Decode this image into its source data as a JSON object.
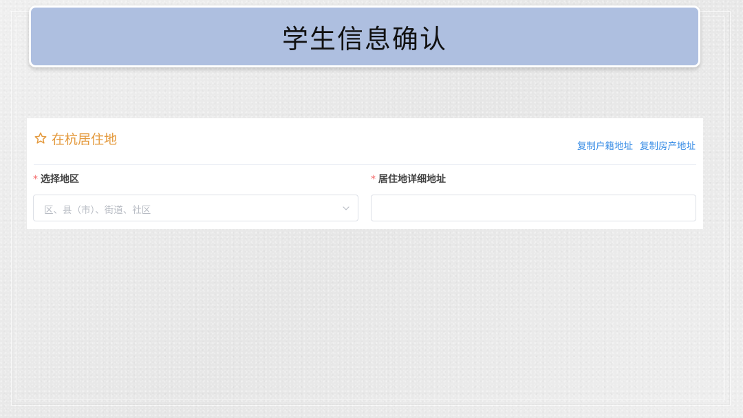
{
  "page": {
    "title": "学生信息确认"
  },
  "section": {
    "icon": "star-outline-icon",
    "title": "在杭居住地",
    "links": [
      {
        "label": "复制户籍地址"
      },
      {
        "label": "复制房产地址"
      }
    ]
  },
  "fields": {
    "region": {
      "required_mark": "*",
      "label": "选择地区",
      "placeholder": "区、县（市）、街道、社区",
      "icon": "chevron-down-icon"
    },
    "address": {
      "required_mark": "*",
      "label": "居住地详细地址",
      "value": ""
    }
  },
  "colors": {
    "banner": "#aebfe0",
    "section_title": "#e49a3e",
    "link": "#3a8ee6",
    "required": "#f56c6c"
  }
}
